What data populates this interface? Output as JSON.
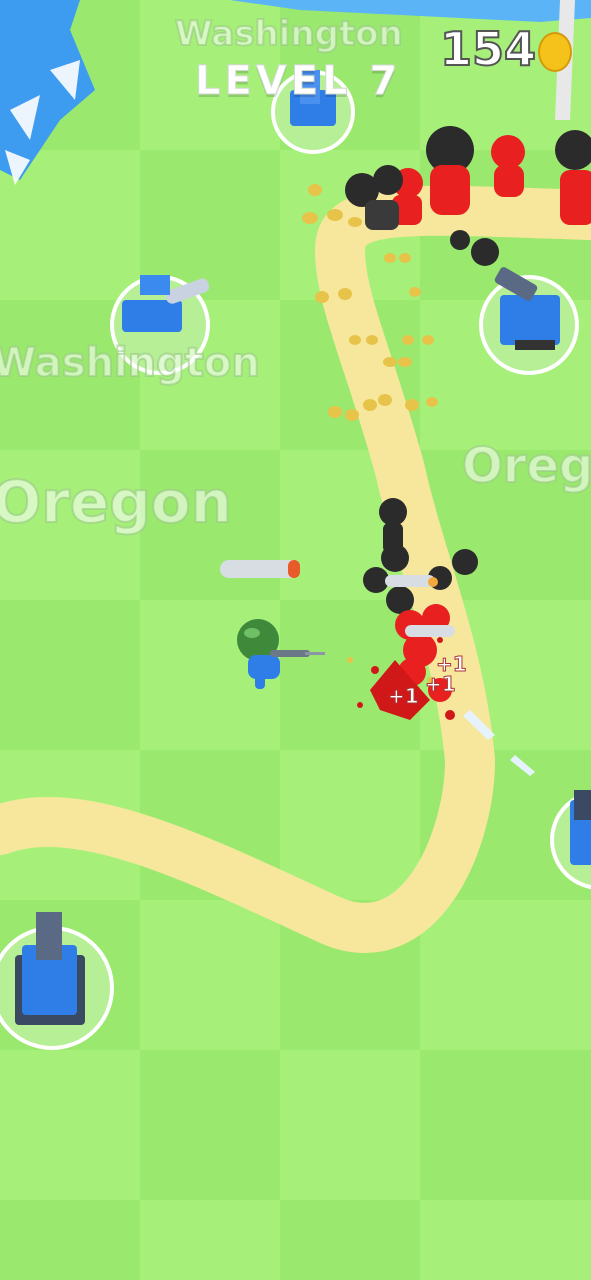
{
  "hud": {
    "level_label": "LEVEL 7",
    "coin_count": "154",
    "coin_icon": "gold-coin-icon"
  },
  "map": {
    "state_labels": [
      {
        "text": "Washington",
        "id": "state-label-washington-top"
      },
      {
        "text": "Washington",
        "id": "state-label-washington-left"
      },
      {
        "text": "Oregon",
        "id": "state-label-oregon-left"
      },
      {
        "text": "Oreg",
        "id": "state-label-oregon-right"
      }
    ]
  },
  "effects": {
    "hit_texts": [
      "+1",
      "+1",
      "+1"
    ]
  },
  "colors": {
    "grass_light": "#a6f07a",
    "grass_dark": "#97e66c",
    "path": "#f6e79c",
    "water": "#3d9cf0",
    "ally_blue": "#2f7ee8",
    "enemy_red": "#e82020",
    "enemy_black": "#2b2b2b",
    "helmet_green": "#3f8a3a"
  }
}
